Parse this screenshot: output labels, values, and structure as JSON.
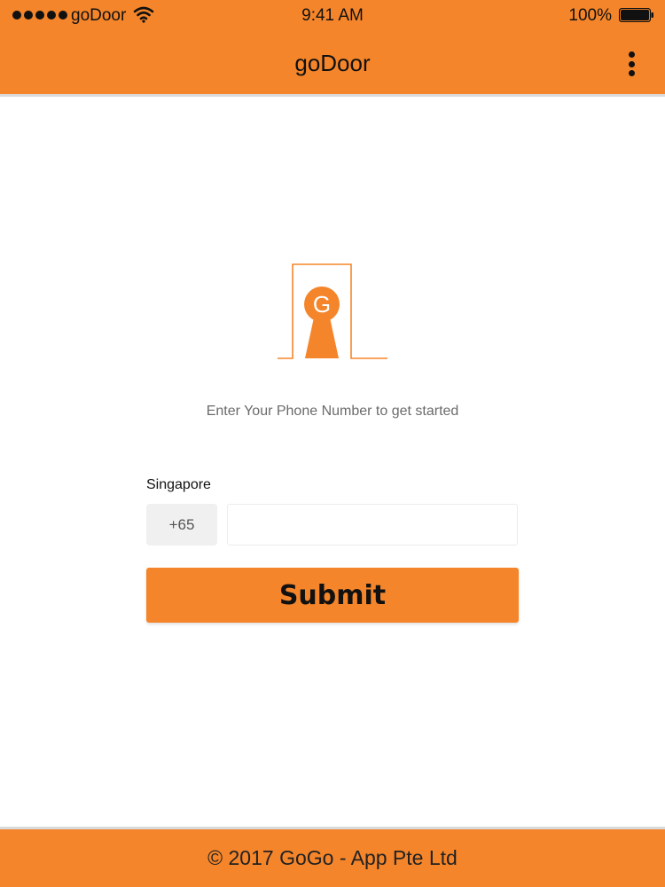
{
  "status_bar": {
    "carrier": "goDoor",
    "time": "9:41 AM",
    "battery": "100%"
  },
  "nav": {
    "title": "goDoor",
    "more_icon": "more-vertical-icon"
  },
  "logo": {
    "letter": "G",
    "icon": "door-keyhole-logo"
  },
  "main": {
    "tagline": "Enter Your Phone Number to get started",
    "country": "Singapore",
    "dial_code": "+65",
    "phone_value": "",
    "phone_placeholder": "",
    "submit_label": "Submit"
  },
  "footer": {
    "text": "© 2017 GoGo - App Pte Ltd"
  },
  "colors": {
    "accent": "#f5852a",
    "input_bg": "#f0f0f0",
    "text_muted": "#6b6b6b"
  }
}
